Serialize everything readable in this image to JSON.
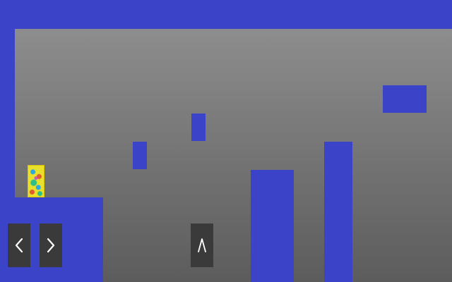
{
  "colors": {
    "wall": "#3b44c8",
    "background_top": "#8d8d8d",
    "background_bottom": "#5c5c5c",
    "button_bg": "#3a3a3a",
    "button_glyph": "#ffffff",
    "player_base": "#e8e02a"
  },
  "controls": {
    "left_icon": "chevron-left-icon",
    "right_icon": "chevron-right-icon",
    "jump_icon": "caret-up-icon"
  }
}
